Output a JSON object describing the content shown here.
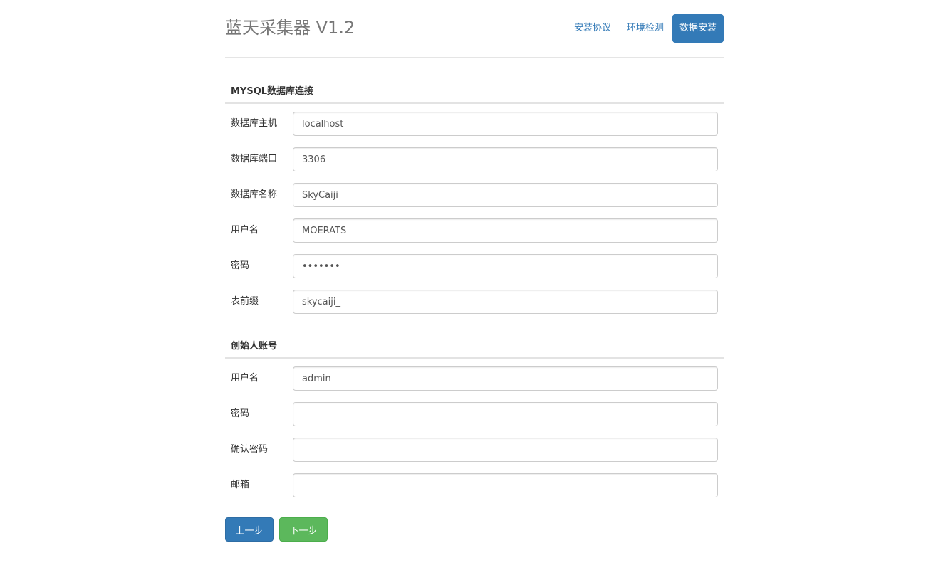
{
  "header": {
    "title": "蓝天采集器 V1.2",
    "nav": [
      {
        "label": "安装协议",
        "active": false
      },
      {
        "label": "环境检测",
        "active": false
      },
      {
        "label": "数据安装",
        "active": true
      }
    ]
  },
  "db_section": {
    "title": "MYSQL数据库连接",
    "fields": [
      {
        "label": "数据库主机",
        "value": "localhost",
        "type": "text"
      },
      {
        "label": "数据库端口",
        "value": "3306",
        "type": "text"
      },
      {
        "label": "数据库名称",
        "value": "SkyCaiji",
        "type": "text"
      },
      {
        "label": "用户名",
        "value": "MOERATS",
        "type": "text"
      },
      {
        "label": "密码",
        "value": "1234567",
        "type": "password"
      },
      {
        "label": "表前缀",
        "value": "skycaiji_",
        "type": "text"
      }
    ]
  },
  "founder_section": {
    "title": "创始人账号",
    "fields": [
      {
        "label": "用户名",
        "value": "admin",
        "type": "text"
      },
      {
        "label": "密码",
        "value": "",
        "type": "password"
      },
      {
        "label": "确认密码",
        "value": "",
        "type": "password"
      },
      {
        "label": "邮箱",
        "value": "",
        "type": "text"
      }
    ]
  },
  "buttons": {
    "prev": "上一步",
    "next": "下一步"
  },
  "colors": {
    "primary": "#337ab7",
    "success": "#5cb85c",
    "brand_text": "#777777"
  }
}
